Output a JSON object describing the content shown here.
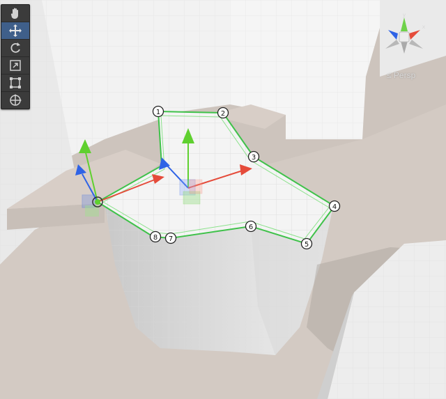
{
  "toolbar": {
    "tools": [
      {
        "id": "hand",
        "label": "Hand Tool",
        "icon": "hand-icon",
        "active": false
      },
      {
        "id": "move",
        "label": "Move Tool",
        "icon": "move-arrows-icon",
        "active": true
      },
      {
        "id": "rotate",
        "label": "Rotate Tool",
        "icon": "rotate-icon",
        "active": false
      },
      {
        "id": "scale",
        "label": "Scale Tool",
        "icon": "scale-icon",
        "active": false
      },
      {
        "id": "rect",
        "label": "Rect Tool",
        "icon": "rect-transform-icon",
        "active": false
      },
      {
        "id": "transform",
        "label": "Transform Tool",
        "icon": "transform-icon",
        "active": false
      }
    ]
  },
  "view": {
    "projection_label": "≤ Persp",
    "gizmo_axes": {
      "y": "y",
      "x": "x"
    }
  },
  "spline": {
    "points": [
      "1",
      "2",
      "3",
      "4",
      "5",
      "6",
      "7",
      "8"
    ],
    "outline_color": "#5cd85c"
  },
  "colors": {
    "x_axis": "#e54b3a",
    "y_axis": "#5fd02f",
    "z_axis": "#2f63e6",
    "toolbar_active": "#3f5f8a"
  }
}
